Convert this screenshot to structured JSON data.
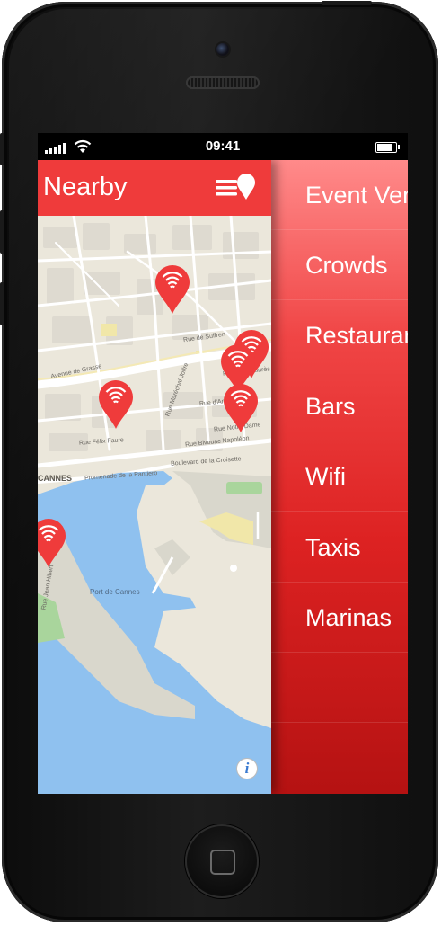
{
  "status_bar": {
    "time": "09:41"
  },
  "nav": {
    "title": "Nearby"
  },
  "drawer": {
    "items": [
      "Event Venues",
      "Crowds",
      "Restaurants",
      "Bars",
      "Wifi",
      "Taxis",
      "Marinas"
    ]
  },
  "map": {
    "labels": {
      "cannes": "CANNES",
      "port": "Port de Cannes",
      "promenade": "Promenade de la Pantiero",
      "croisette": "Boulevard de la Croisette",
      "antibes": "Rue d'Antibes",
      "grasse": "Avenue de Grasse",
      "felix": "Rue Félix Faure",
      "jean_jaures": "Rue Jean Jaurès",
      "suffren": "Rue de Suffren",
      "napoleon": "Rue Bivouac Napoléon",
      "notre_dame": "Rue Notre Dame",
      "hibert": "Rue Jean Hibert",
      "marechal": "Rue Maréchal Joffre"
    },
    "pin_icon": "wifi-icon",
    "pin_count": 6
  },
  "colors": {
    "accent": "#ef3b3b",
    "water": "#8fc1ef",
    "park": "#a9d59c"
  }
}
